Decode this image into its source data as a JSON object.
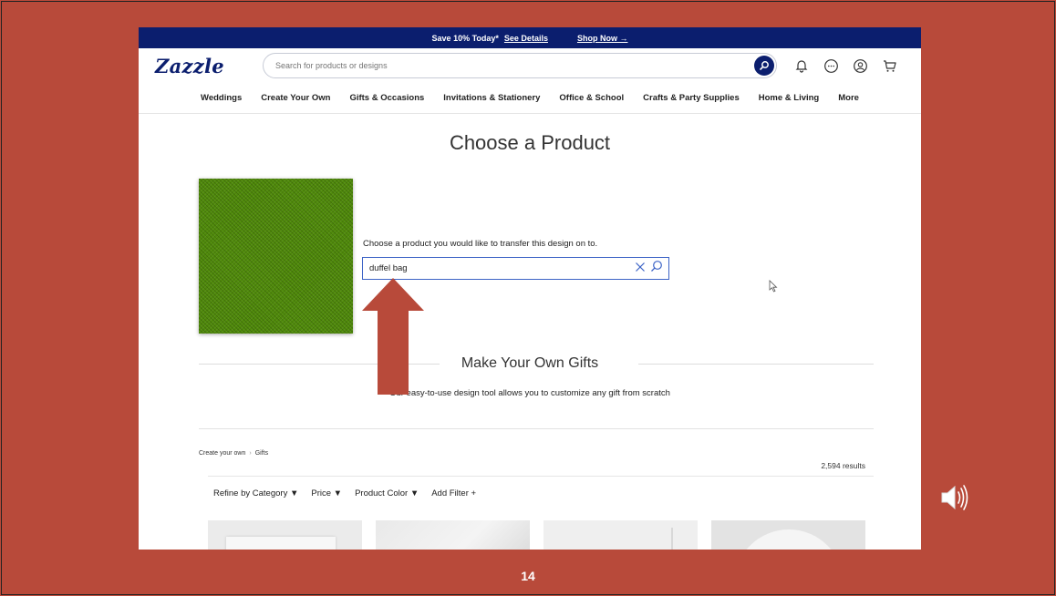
{
  "promo": {
    "text": "Save 10% Today*",
    "details_link": "See Details",
    "shop_link": "Shop Now →"
  },
  "header": {
    "logo": "Zazzle",
    "search_placeholder": "Search for products or designs",
    "icons": [
      "search-icon",
      "bell-icon",
      "chat-icon",
      "account-icon",
      "cart-icon"
    ]
  },
  "nav": {
    "items": [
      "Weddings",
      "Create Your Own",
      "Gifts & Occasions",
      "Invitations & Stationery",
      "Office & School",
      "Crafts & Party Supplies",
      "Home & Living",
      "More"
    ]
  },
  "main": {
    "title": "Choose a Product",
    "instruction": "Choose a product you would like to transfer this design on to.",
    "product_search_value": "duffel bag",
    "swatch_color": "#4f8a0a"
  },
  "section": {
    "title": "Make Your Own Gifts",
    "subtitle": "Our easy-to-use design tool allows you to customize any gift from scratch"
  },
  "breadcrumb": {
    "items": [
      "Create your own",
      "Gifts"
    ]
  },
  "results": {
    "count": "2,594 results"
  },
  "filters": {
    "refine": "Refine by Category",
    "price": "Price",
    "color": "Product Color",
    "add": "Add Filter +"
  },
  "slide": {
    "number": "14",
    "background": "#b84a3a",
    "arrow_color": "#b84a3a"
  }
}
